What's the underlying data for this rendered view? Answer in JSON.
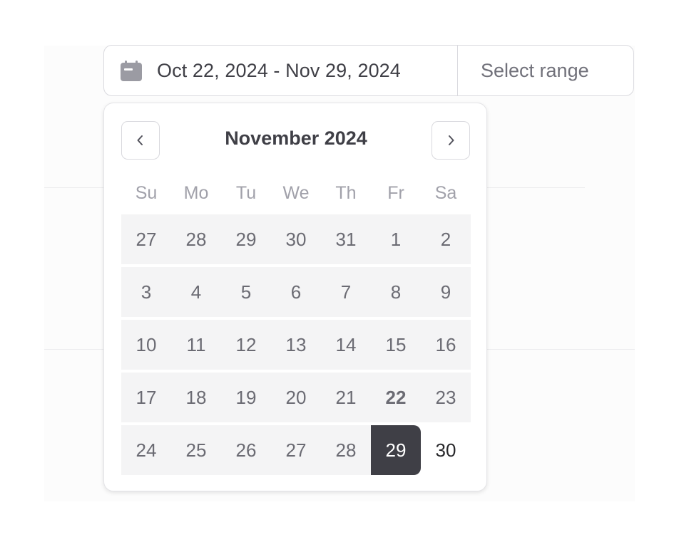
{
  "picker": {
    "range_label": "Oct 22, 2024 - Nov 29, 2024",
    "preset_label": "Select range",
    "icon": "calendar-icon"
  },
  "calendar": {
    "month_title": "November 2024",
    "prev_icon": "chevron-left-icon",
    "next_icon": "chevron-right-icon",
    "weekdays": [
      "Su",
      "Mo",
      "Tu",
      "We",
      "Th",
      "Fr",
      "Sa"
    ],
    "weeks": [
      [
        "27",
        "28",
        "29",
        "30",
        "31",
        "1",
        "2"
      ],
      [
        "3",
        "4",
        "5",
        "6",
        "7",
        "8",
        "9"
      ],
      [
        "10",
        "11",
        "12",
        "13",
        "14",
        "15",
        "16"
      ],
      [
        "17",
        "18",
        "19",
        "20",
        "21",
        "22",
        "23"
      ],
      [
        "24",
        "25",
        "26",
        "27",
        "28",
        "29",
        "30"
      ]
    ],
    "selected_day": "29",
    "emphasized_day": "22"
  },
  "colors": {
    "selected_bg": "#3f3f46",
    "range_bg": "#f4f4f5",
    "border": "#d9d9de"
  }
}
